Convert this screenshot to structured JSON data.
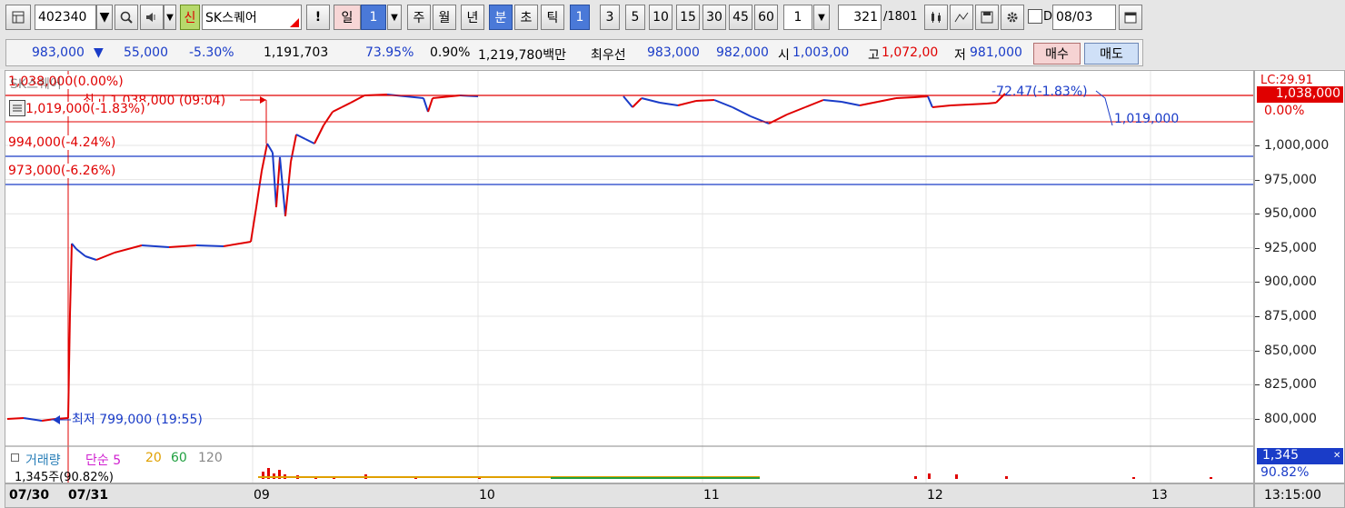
{
  "toolbar": {
    "code": "402340",
    "badge": "신",
    "name": "SK스퀘어",
    "bang": "!",
    "period_prefix": "일",
    "period_num": "1",
    "periods": [
      "주",
      "월",
      "년",
      "분",
      "초",
      "틱"
    ],
    "active_period": "분",
    "intervals": [
      "1",
      "3",
      "5",
      "10",
      "15",
      "30",
      "45",
      "60"
    ],
    "active_interval": "1",
    "count_value": "1",
    "count_input": "321",
    "count_total": "/1801",
    "date_prefix": "D",
    "date_value": "08/03"
  },
  "quote": {
    "price": "983,000",
    "arrow": "▼",
    "change": "55,000",
    "change_pct": "-5.30%",
    "volume": "1,191,703",
    "vol_ratio": "73.95%",
    "turnover_pct": "0.90%",
    "amount": "1,219,780백만",
    "best_label": "최우선",
    "best_ask": "983,000",
    "best_bid": "982,000",
    "open_label": "시",
    "open": "1,003,00",
    "high_label": "고",
    "high": "1,072,00",
    "low_label": "저",
    "low": "981,000",
    "buy": "매수",
    "sell": "매도"
  },
  "chart": {
    "top_label": "1,038,000(0.00%)",
    "top_label_alt": "SK스퀘어",
    "max_annot": "최고 1,038,000 (09:04)",
    "ref1": "1,019,000(-1.83%)",
    "ref2": "994,000(-4.24%)",
    "ref3": "973,000(-6.26%)",
    "diff_annot": "-72.47(-1.83%)",
    "diff_price": "1,019,000",
    "min_annot": "최저 799,000 (19:55)",
    "vol_legend": [
      "거래량",
      "단순 5",
      "20",
      "60",
      "120"
    ],
    "vol_legend_colors": [
      "#2a7fb8",
      "#d020d0",
      "#e0a000",
      "#20a040",
      "#888888"
    ],
    "vol_sub": "1,345주(90.82%)",
    "axis_top": "LC:29.91",
    "axis_price": "1,038,000",
    "axis_pct": "0.00%",
    "axis_vol": "1,345",
    "axis_vol_pct": "90.82%",
    "y_ticks": [
      "1,000,000",
      "975,000",
      "950,000",
      "925,000",
      "900,000",
      "875,000",
      "850,000",
      "825,000",
      "800,000"
    ],
    "x_labels": [
      "07/30",
      "07/31",
      "09",
      "10",
      "11",
      "12",
      "13"
    ],
    "time": "13:15:00"
  },
  "colors": {
    "up": "#e00000",
    "down": "#1a3cc8",
    "accent": "#4a79d8"
  }
}
